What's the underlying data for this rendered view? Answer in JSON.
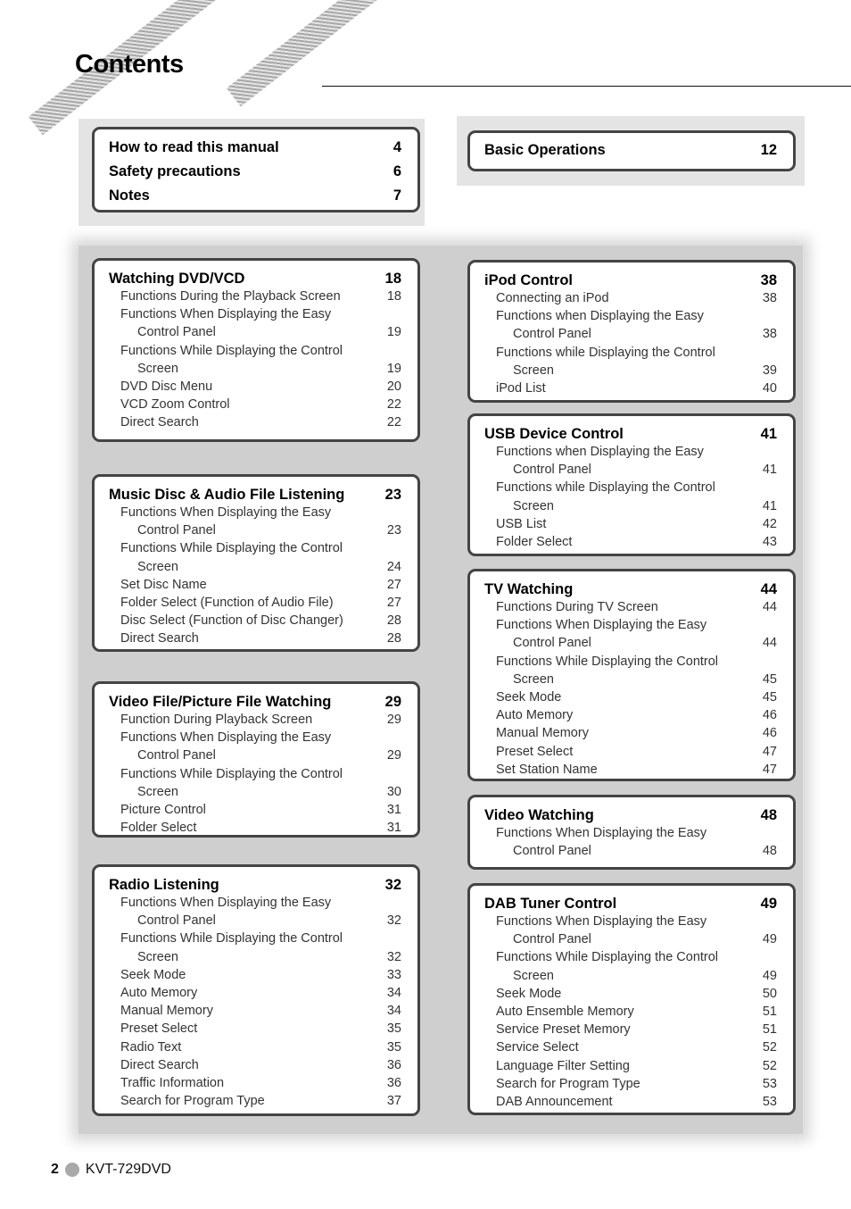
{
  "page": {
    "title": "Contents",
    "footer": {
      "page_number": "2",
      "model": "KVT-729DVD"
    }
  },
  "intro_box": {
    "items": [
      {
        "label": "How to read this manual",
        "page": "4"
      },
      {
        "label": "Safety precautions",
        "page": "6"
      },
      {
        "label": "Notes",
        "page": "7"
      }
    ]
  },
  "basic_box": {
    "items": [
      {
        "label": "Basic Operations",
        "page": "12"
      }
    ]
  },
  "sections": [
    {
      "title": "Watching DVD/VCD",
      "page": "18",
      "items": [
        {
          "label": "Functions During the Playback Screen",
          "page": "18"
        },
        {
          "label": "Functions When Displaying the Easy",
          "cont": "Control Panel",
          "page": "19"
        },
        {
          "label": "Functions While Displaying the Control",
          "cont": "Screen",
          "page": "19"
        },
        {
          "label": "DVD Disc Menu",
          "page": "20"
        },
        {
          "label": "VCD Zoom Control",
          "page": "22"
        },
        {
          "label": "Direct Search",
          "page": "22"
        }
      ]
    },
    {
      "title": "Music Disc & Audio File Listening",
      "page": "23",
      "items": [
        {
          "label": "Functions When Displaying the Easy",
          "cont": "Control Panel",
          "page": "23"
        },
        {
          "label": "Functions While Displaying the Control",
          "cont": "Screen",
          "page": "24"
        },
        {
          "label": "Set Disc Name",
          "page": "27"
        },
        {
          "label": "Folder Select (Function of Audio File)",
          "page": "27"
        },
        {
          "label": "Disc Select (Function of Disc Changer)",
          "page": "28"
        },
        {
          "label": "Direct Search",
          "page": "28"
        }
      ]
    },
    {
      "title": "Video File/Picture File Watching",
      "page": "29",
      "items": [
        {
          "label": "Function During Playback Screen",
          "page": "29"
        },
        {
          "label": "Functions When Displaying the Easy",
          "cont": "Control Panel",
          "page": "29"
        },
        {
          "label": "Functions While Displaying the Control",
          "cont": "Screen",
          "page": "30"
        },
        {
          "label": "Picture Control",
          "page": "31"
        },
        {
          "label": "Folder Select",
          "page": "31"
        }
      ]
    },
    {
      "title": "Radio Listening",
      "page": "32",
      "items": [
        {
          "label": "Functions When Displaying the Easy",
          "cont": "Control Panel",
          "page": "32"
        },
        {
          "label": "Functions While Displaying the Control",
          "cont": "Screen",
          "page": "32"
        },
        {
          "label": "Seek Mode",
          "page": "33"
        },
        {
          "label": "Auto Memory",
          "page": "34"
        },
        {
          "label": "Manual Memory",
          "page": "34"
        },
        {
          "label": "Preset Select",
          "page": "35"
        },
        {
          "label": "Radio Text",
          "page": "35"
        },
        {
          "label": "Direct Search",
          "page": "36"
        },
        {
          "label": "Traffic Information",
          "page": "36"
        },
        {
          "label": "Search for Program Type",
          "page": "37"
        }
      ]
    },
    {
      "title": "iPod Control",
      "page": "38",
      "items": [
        {
          "label": "Connecting an iPod",
          "page": "38"
        },
        {
          "label": "Functions when Displaying the Easy",
          "cont": "Control Panel",
          "page": "38"
        },
        {
          "label": "Functions while Displaying the Control",
          "cont": "Screen",
          "page": "39"
        },
        {
          "label": "iPod List",
          "page": "40"
        }
      ]
    },
    {
      "title": "USB Device Control",
      "page": "41",
      "items": [
        {
          "label": "Functions when Displaying the Easy",
          "cont": "Control Panel",
          "page": "41"
        },
        {
          "label": "Functions while Displaying the Control",
          "cont": "Screen",
          "page": "41"
        },
        {
          "label": "USB List",
          "page": "42"
        },
        {
          "label": "Folder Select",
          "page": "43"
        }
      ]
    },
    {
      "title": "TV Watching",
      "page": "44",
      "items": [
        {
          "label": "Functions During TV Screen",
          "page": "44"
        },
        {
          "label": "Functions When Displaying the Easy",
          "cont": "Control Panel",
          "page": "44"
        },
        {
          "label": "Functions While Displaying the Control",
          "cont": "Screen",
          "page": "45"
        },
        {
          "label": "Seek Mode",
          "page": "45"
        },
        {
          "label": "Auto Memory",
          "page": "46"
        },
        {
          "label": "Manual Memory",
          "page": "46"
        },
        {
          "label": "Preset Select",
          "page": "47"
        },
        {
          "label": "Set Station Name",
          "page": "47"
        }
      ]
    },
    {
      "title": "Video Watching",
      "page": "48",
      "items": [
        {
          "label": "Functions When Displaying the Easy",
          "cont": "Control Panel",
          "page": "48"
        }
      ]
    },
    {
      "title": "DAB Tuner Control",
      "page": "49",
      "items": [
        {
          "label": "Functions When Displaying the Easy",
          "cont": "Control Panel",
          "page": "49"
        },
        {
          "label": "Functions While Displaying the Control",
          "cont": "Screen",
          "page": "49"
        },
        {
          "label": "Seek Mode",
          "page": "50"
        },
        {
          "label": "Auto Ensemble Memory",
          "page": "51"
        },
        {
          "label": "Service Preset Memory",
          "page": "51"
        },
        {
          "label": "Service Select",
          "page": "52"
        },
        {
          "label": "Language Filter Setting",
          "page": "52"
        },
        {
          "label": "Search for Program Type",
          "page": "53"
        },
        {
          "label": "DAB Announcement",
          "page": "53"
        }
      ]
    }
  ]
}
